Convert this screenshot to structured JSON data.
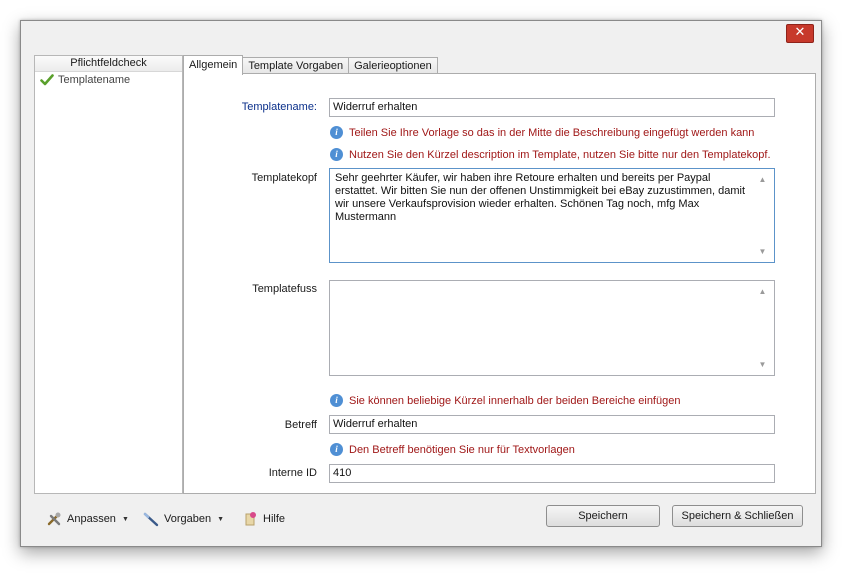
{
  "window": {
    "close_label": "✕"
  },
  "left_panel": {
    "header": "Pflichtfeldcheck",
    "items": [
      {
        "label": "Templatename"
      }
    ]
  },
  "tabs": [
    {
      "label": "Allgemein",
      "active": true
    },
    {
      "label": "Template Vorgaben",
      "active": false
    },
    {
      "label": "Galerieoptionen",
      "active": false
    }
  ],
  "form": {
    "templatename": {
      "label": "Templatename:",
      "value": "Widerruf erhalten"
    },
    "hint1": "Teilen Sie Ihre Vorlage so das in der Mitte die Beschreibung eingefügt werden kann",
    "hint2": "Nutzen Sie den Kürzel description im Template, nutzen Sie bitte nur den Templatekopf.",
    "templatekopf": {
      "label": "Templatekopf",
      "value": "Sehr geehrter Käufer, wir haben ihre Retoure erhalten und bereits per Paypal erstattet. Wir bitten Sie nun der offenen Unstimmigkeit bei eBay zuzustimmen, damit wir unsere Verkaufsprovision wieder erhalten. Schönen Tag noch, mfg Max Mustermann"
    },
    "templatefuss": {
      "label": "Templatefuss",
      "value": ""
    },
    "hint3": "Sie können beliebige Kürzel innerhalb der beiden Bereiche einfügen",
    "betreff": {
      "label": "Betreff",
      "value": "Widerruf erhalten"
    },
    "hint4": "Den Betreff benötigen Sie nur für Textvorlagen",
    "interne_id": {
      "label": "Interne ID",
      "value": "410"
    }
  },
  "bottom": {
    "anpassen": "Anpassen",
    "vorgaben": "Vorgaben",
    "hilfe": "Hilfe",
    "speichern": "Speichern",
    "speichern_schliessen": "Speichern & Schließen"
  },
  "colors": {
    "accent": "#0a2f8a",
    "hint": "#a01818",
    "close": "#c7392b",
    "info": "#4f8fd4"
  }
}
